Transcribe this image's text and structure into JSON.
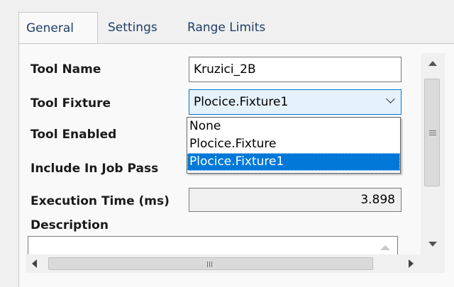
{
  "tabs": [
    {
      "label": "General",
      "active": true
    },
    {
      "label": "Settings",
      "active": false
    },
    {
      "label": "Range Limits",
      "active": false
    }
  ],
  "fields": {
    "tool_name": {
      "label": "Tool Name",
      "value": "Kruzici_2B"
    },
    "tool_fixture": {
      "label": "Tool Fixture",
      "value": "Plocice.Fixture1",
      "options": [
        "None",
        "Plocice.Fixture",
        "Plocice.Fixture1"
      ],
      "selected_index": 2
    },
    "tool_enabled": {
      "label": "Tool Enabled"
    },
    "include_in_job_pass": {
      "label": "Include In Job Pass"
    },
    "execution_time": {
      "label": "Execution Time (ms)",
      "value": "3.898"
    },
    "description": {
      "label": "Description",
      "value": ""
    }
  },
  "icons": {
    "scroll_up": "triangle-up-icon",
    "scroll_down": "triangle-down-icon",
    "scroll_left": "triangle-left-icon",
    "scroll_right": "triangle-right-icon",
    "combo_arrow": "chevron-down-icon"
  },
  "colors": {
    "accent": "#0078d7",
    "combo_background": "#e5f1fb",
    "tab_text": "#1e3f66"
  }
}
